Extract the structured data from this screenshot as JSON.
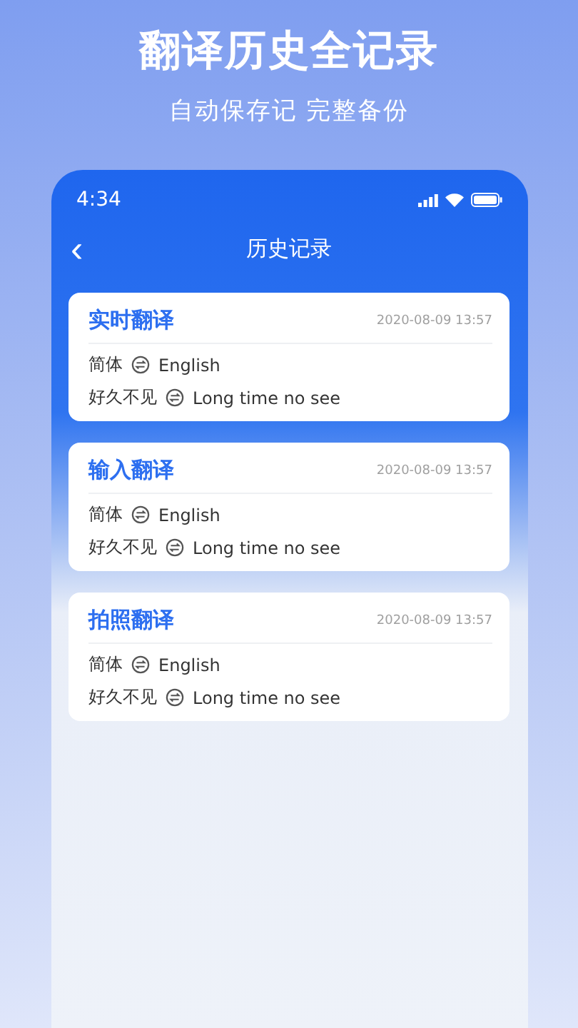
{
  "promo": {
    "headline": "翻译历史全记录",
    "subtitle": "自动保存记 完整备份"
  },
  "status_bar": {
    "time": "4:34"
  },
  "nav": {
    "back": "‹",
    "title": "历史记录"
  },
  "records": [
    {
      "type": "实时翻译",
      "time": "2020-08-09 13:57",
      "source_lang": "简体",
      "target_lang": "English",
      "source_text": "好久不见",
      "target_text": "Long time no see"
    },
    {
      "type": "输入翻译",
      "time": "2020-08-09 13:57",
      "source_lang": "简体",
      "target_lang": "English",
      "source_text": "好久不见",
      "target_text": "Long time no see"
    },
    {
      "type": "拍照翻译",
      "time": "2020-08-09 13:57",
      "source_lang": "简体",
      "target_lang": "English",
      "source_text": "好久不见",
      "target_text": "Long time no see"
    }
  ]
}
